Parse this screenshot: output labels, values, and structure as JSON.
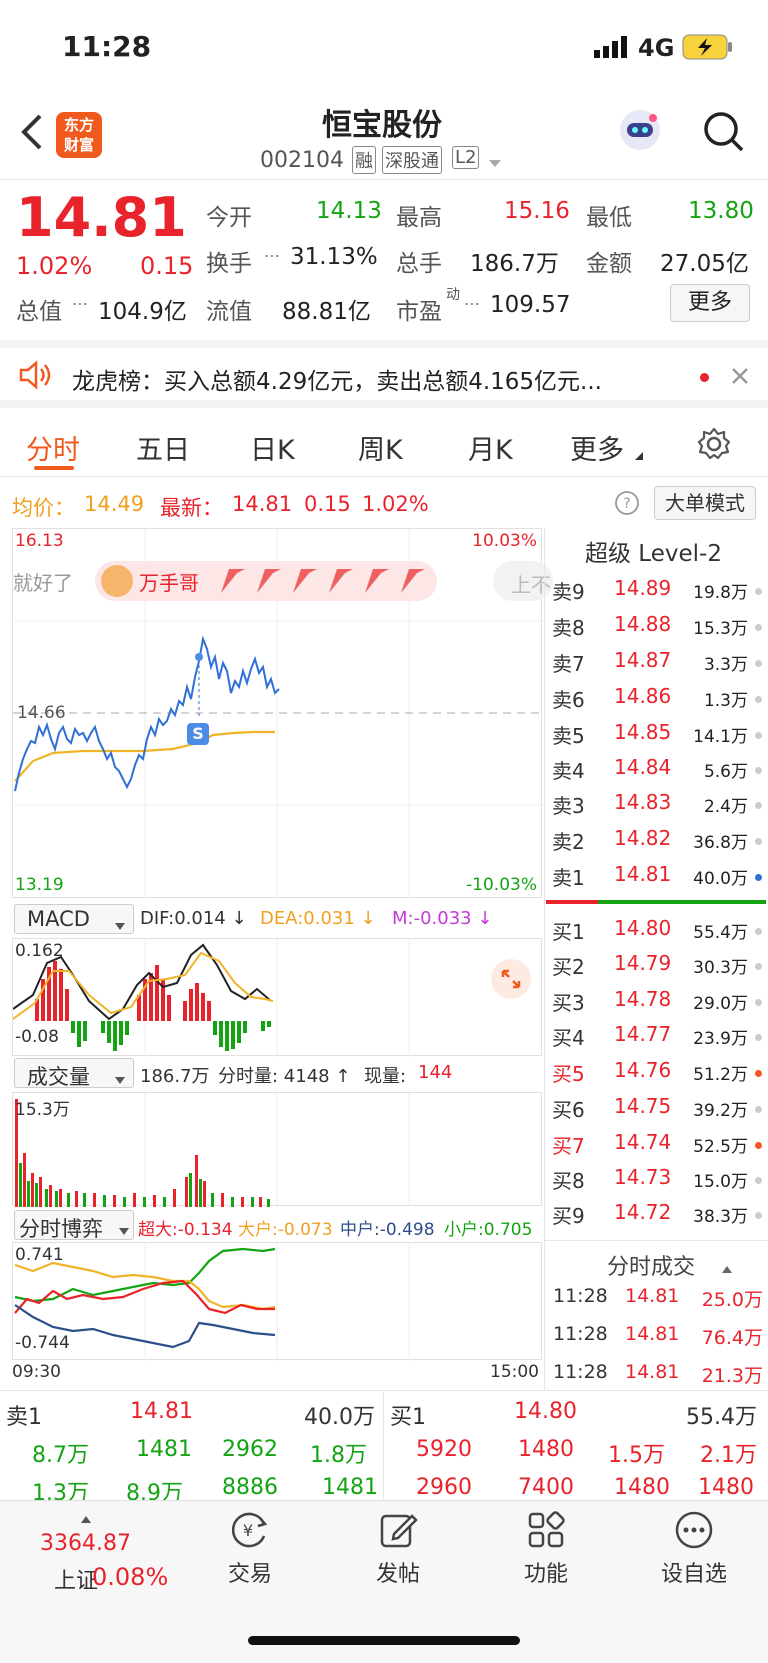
{
  "status_bar": {
    "time": "11:28",
    "network": "4G"
  },
  "header": {
    "logo_line1": "东方",
    "logo_line2": "财富",
    "stock_name": "恒宝股份",
    "stock_code": "002104",
    "tag_margin": "融",
    "tag_connect": "深股通",
    "tag_level": "L2"
  },
  "quote": {
    "price": "14.81",
    "change_pct": "1.02%",
    "change": "0.15",
    "open_label": "今开",
    "open": "14.13",
    "high_label": "最高",
    "high": "15.16",
    "low_label": "最低",
    "low": "13.80",
    "turnover_label": "换手",
    "turnover": "31.13%",
    "volume_label": "总手",
    "volume": "186.7万",
    "amount_label": "金额",
    "amount": "27.05亿",
    "mktcap_label": "总值",
    "mktcap": "104.9亿",
    "float_label": "流值",
    "float": "88.81亿",
    "pe_label": "市盈",
    "pe_sup": "动",
    "pe": "109.57",
    "more_button": "更多"
  },
  "notice": {
    "text": "龙虎榜：买入总额4.29亿元，卖出总额4.165亿元..."
  },
  "tabs": [
    "分时",
    "五日",
    "日K",
    "周K",
    "月K",
    "更多"
  ],
  "chart_info": {
    "avg_label": "均价：",
    "avg": "14.49",
    "last_label": "最新：",
    "last": "14.81",
    "chg": "0.15",
    "chg_pct": "1.02%",
    "big_order_button": "大单模式"
  },
  "price_chart": {
    "y_top": "16.13",
    "y_mid": "14.66",
    "y_bottom": "13.19",
    "pct_top": "10.03%",
    "pct_bottom": "-10.03%",
    "banner_left": "就好了",
    "banner_user": "万手哥",
    "banner_right": "上不",
    "marker": "S"
  },
  "macd": {
    "selector": "MACD",
    "dif": "DIF:0.014 ↓",
    "dea": "DEA:0.031 ↓",
    "m": "M:-0.033 ↓",
    "y_top": "0.162",
    "y_bottom": "-0.08"
  },
  "volume_chart": {
    "selector": "成交量",
    "total": "186.7万",
    "period_label": "分时量: 4148 ↑",
    "now_label": "现量:",
    "now": "144",
    "y_top": "15.3万"
  },
  "flow_chart": {
    "selector": "分时博弈",
    "super": "超大:-0.134",
    "large": "大户:-0.073",
    "mid": "中户:-0.498",
    "small": "小户:0.705",
    "y_top": "0.741",
    "y_bottom": "-0.744",
    "time_start": "09:30",
    "time_end": "15:00"
  },
  "order_book": {
    "title": "超级 Level-2",
    "asks": [
      {
        "label": "卖9",
        "price": "14.89",
        "vol": "19.8万"
      },
      {
        "label": "卖8",
        "price": "14.88",
        "vol": "15.3万"
      },
      {
        "label": "卖7",
        "price": "14.87",
        "vol": "3.3万"
      },
      {
        "label": "卖6",
        "price": "14.86",
        "vol": "1.3万"
      },
      {
        "label": "卖5",
        "price": "14.85",
        "vol": "14.1万"
      },
      {
        "label": "卖4",
        "price": "14.84",
        "vol": "5.6万"
      },
      {
        "label": "卖3",
        "price": "14.83",
        "vol": "2.4万"
      },
      {
        "label": "卖2",
        "price": "14.82",
        "vol": "36.8万"
      },
      {
        "label": "卖1",
        "price": "14.81",
        "vol": "40.0万"
      }
    ],
    "bids": [
      {
        "label": "买1",
        "price": "14.80",
        "vol": "55.4万"
      },
      {
        "label": "买2",
        "price": "14.79",
        "vol": "30.3万"
      },
      {
        "label": "买3",
        "price": "14.78",
        "vol": "29.0万"
      },
      {
        "label": "买4",
        "price": "14.77",
        "vol": "23.9万"
      },
      {
        "label": "买5",
        "price": "14.76",
        "vol": "51.2万"
      },
      {
        "label": "买6",
        "price": "14.75",
        "vol": "39.2万"
      },
      {
        "label": "买7",
        "price": "14.74",
        "vol": "52.5万"
      },
      {
        "label": "买8",
        "price": "14.73",
        "vol": "15.0万"
      },
      {
        "label": "买9",
        "price": "14.72",
        "vol": "38.3万"
      }
    ],
    "trades_title": "分时成交",
    "trades": [
      {
        "time": "11:28",
        "price": "14.81",
        "vol": "25.0万"
      },
      {
        "time": "11:28",
        "price": "14.81",
        "vol": "76.4万"
      },
      {
        "time": "11:28",
        "price": "14.81",
        "vol": "21.3万"
      }
    ]
  },
  "queue": {
    "ask_label": "卖1",
    "ask_price": "14.81",
    "ask_total": "40.0万",
    "bid_label": "买1",
    "bid_price": "14.80",
    "bid_total": "55.4万",
    "ask_row1": [
      "8.7万",
      "1481",
      "2962",
      "1.8万"
    ],
    "ask_row2": [
      "1.3万",
      "8.9万",
      "8886",
      "1481"
    ],
    "bid_row1": [
      "5920",
      "1480",
      "1.5万",
      "2.1万"
    ],
    "bid_row2": [
      "2960",
      "7400",
      "1480",
      "1480"
    ]
  },
  "bottom_nav": {
    "index_value": "3364.87",
    "index_name": "上证",
    "index_pct": "0.08%",
    "trade": "交易",
    "post": "发帖",
    "function": "功能",
    "watchlist": "设自选"
  },
  "colors": {
    "up": "#e8232b",
    "down": "#13a313",
    "accent": "#f05a1e"
  }
}
